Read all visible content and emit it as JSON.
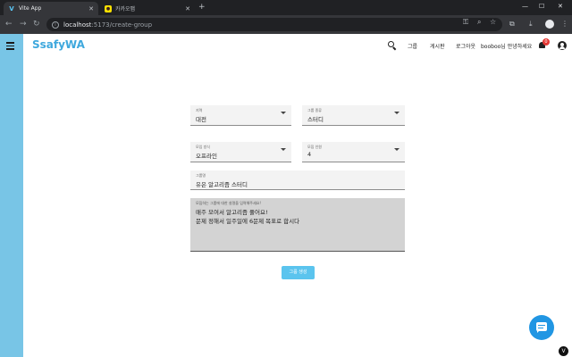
{
  "browser": {
    "tabs": [
      {
        "title": "Vite App",
        "icon": "vite-icon"
      },
      {
        "title": "카카오맵",
        "icon": "kakaomap-icon"
      }
    ],
    "url_host": "localhost",
    "url_path": ":5173/create-group"
  },
  "app": {
    "brand": "SsafyWA",
    "nav": {
      "group": "그룹",
      "board": "게시판",
      "logout": "로그아웃",
      "greeting": "booboo님 안녕하세요"
    },
    "notification_count": "0",
    "accent_color": "#3ea8dd",
    "sidebar_color": "#78c5e6"
  },
  "form": {
    "region": {
      "label": "지역",
      "value": "대전"
    },
    "group_type": {
      "label": "그룹 종류",
      "value": "스터디"
    },
    "meeting_method": {
      "label": "모임 방식",
      "value": "오프라인"
    },
    "member_count": {
      "label": "모집 인원",
      "value": "4"
    },
    "group_name": {
      "label": "그룹명",
      "value": "유은 알고리즘 스터디"
    },
    "description": {
      "label": "모집하는 그룹에 대한 설명을 입력해주세요!",
      "lines": [
        "매주 모여서 알고리즘 풀어요!",
        "문제 정해서 일주일에 6문제 목표로 합시다"
      ]
    },
    "submit_label": "그룹 생성"
  }
}
